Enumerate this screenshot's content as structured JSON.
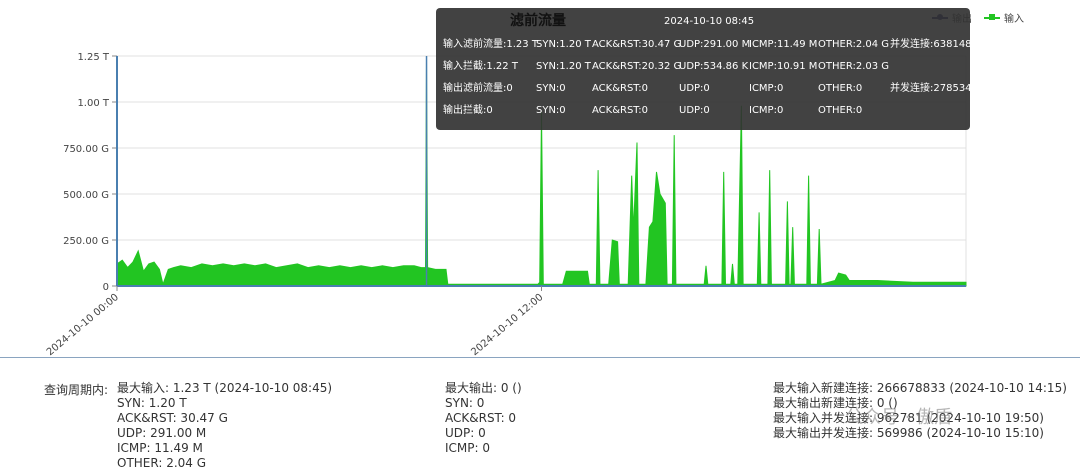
{
  "legend": {
    "output": "输出",
    "input": "输入"
  },
  "colors": {
    "input": "#22c522",
    "output": "#1a1a6e",
    "axis": "#4a7fb0",
    "grid": "#e0e0e0"
  },
  "tooltip": {
    "title": "滤前流量",
    "time": "2024-10-10 08:45",
    "rows": [
      [
        "输入滤前流量:1.23 T",
        "SYN:1.20 T",
        "ACK&RST:30.47 G",
        "UDP:291.00 M",
        "ICMP:11.49 M",
        "OTHER:2.04 G",
        "并发连接:638148"
      ],
      [
        "输入拦截:1.22 T",
        "SYN:1.20 T",
        "ACK&RST:20.32 G",
        "UDP:534.86 K",
        "ICMP:10.91 M",
        "OTHER:2.03 G",
        ""
      ],
      [
        "输出滤前流量:0",
        "SYN:0",
        "ACK&RST:0",
        "UDP:0",
        "ICMP:0",
        "OTHER:0",
        "并发连接:278534"
      ],
      [
        "输出拦截:0",
        "SYN:0",
        "ACK&RST:0",
        "UDP:0",
        "ICMP:0",
        "OTHER:0",
        ""
      ]
    ]
  },
  "chart_data": {
    "type": "area",
    "ylim": [
      0,
      1.25
    ],
    "y_unit": "T",
    "y_ticks": [
      0,
      0.25,
      0.5,
      0.75,
      1.0,
      1.25
    ],
    "y_tick_labels": [
      "0",
      "250.00 G",
      "500.00 G",
      "750.00 G",
      "1.00 T",
      "1.25 T"
    ],
    "x_range_hours": [
      0,
      24
    ],
    "x_tick_hours": [
      0,
      12
    ],
    "x_tick_labels": [
      "2024-10-10 00:00",
      "2024-10-10 12:00"
    ],
    "grid": true,
    "legend_position": "top-right",
    "series": [
      {
        "name": "输入",
        "points": [
          [
            0.0,
            0.12
          ],
          [
            0.15,
            0.14
          ],
          [
            0.3,
            0.1
          ],
          [
            0.45,
            0.13
          ],
          [
            0.6,
            0.19
          ],
          [
            0.75,
            0.08
          ],
          [
            0.9,
            0.12
          ],
          [
            1.05,
            0.13
          ],
          [
            1.2,
            0.09
          ],
          [
            1.3,
            0.01
          ],
          [
            1.45,
            0.09
          ],
          [
            1.6,
            0.1
          ],
          [
            1.8,
            0.11
          ],
          [
            2.1,
            0.1
          ],
          [
            2.4,
            0.12
          ],
          [
            2.7,
            0.11
          ],
          [
            3.0,
            0.12
          ],
          [
            3.3,
            0.11
          ],
          [
            3.6,
            0.12
          ],
          [
            3.9,
            0.11
          ],
          [
            4.2,
            0.12
          ],
          [
            4.5,
            0.1
          ],
          [
            4.8,
            0.11
          ],
          [
            5.1,
            0.12
          ],
          [
            5.4,
            0.1
          ],
          [
            5.7,
            0.11
          ],
          [
            6.0,
            0.1
          ],
          [
            6.3,
            0.11
          ],
          [
            6.6,
            0.1
          ],
          [
            6.9,
            0.11
          ],
          [
            7.2,
            0.1
          ],
          [
            7.5,
            0.11
          ],
          [
            7.8,
            0.1
          ],
          [
            8.1,
            0.11
          ],
          [
            8.4,
            0.11
          ],
          [
            8.6,
            0.1
          ],
          [
            8.72,
            0.1
          ],
          [
            8.75,
            1.23
          ],
          [
            8.78,
            0.1
          ],
          [
            9.0,
            0.09
          ],
          [
            9.3,
            0.09
          ],
          [
            9.35,
            0.01
          ],
          [
            10.0,
            0.01
          ],
          [
            11.0,
            0.01
          ],
          [
            11.9,
            0.01
          ],
          [
            11.95,
            0.02
          ],
          [
            12.0,
            0.95
          ],
          [
            12.05,
            0.01
          ],
          [
            12.6,
            0.01
          ],
          [
            12.7,
            0.08
          ],
          [
            13.3,
            0.08
          ],
          [
            13.35,
            0.01
          ],
          [
            13.55,
            0.01
          ],
          [
            13.6,
            0.63
          ],
          [
            13.65,
            0.01
          ],
          [
            13.9,
            0.01
          ],
          [
            14.0,
            0.25
          ],
          [
            14.15,
            0.24
          ],
          [
            14.2,
            0.01
          ],
          [
            14.45,
            0.01
          ],
          [
            14.55,
            0.6
          ],
          [
            14.6,
            0.3
          ],
          [
            14.7,
            0.78
          ],
          [
            14.75,
            0.01
          ],
          [
            14.95,
            0.01
          ],
          [
            15.05,
            0.32
          ],
          [
            15.15,
            0.35
          ],
          [
            15.25,
            0.62
          ],
          [
            15.35,
            0.5
          ],
          [
            15.5,
            0.45
          ],
          [
            15.55,
            0.01
          ],
          [
            15.7,
            0.01
          ],
          [
            15.75,
            0.82
          ],
          [
            15.8,
            0.01
          ],
          [
            16.6,
            0.01
          ],
          [
            16.65,
            0.11
          ],
          [
            16.7,
            0.01
          ],
          [
            17.1,
            0.01
          ],
          [
            17.15,
            0.62
          ],
          [
            17.2,
            0.01
          ],
          [
            17.35,
            0.01
          ],
          [
            17.4,
            0.12
          ],
          [
            17.45,
            0.01
          ],
          [
            17.55,
            0.01
          ],
          [
            17.65,
            0.98
          ],
          [
            17.7,
            0.01
          ],
          [
            18.1,
            0.01
          ],
          [
            18.15,
            0.4
          ],
          [
            18.2,
            0.01
          ],
          [
            18.4,
            0.01
          ],
          [
            18.45,
            0.63
          ],
          [
            18.5,
            0.01
          ],
          [
            18.9,
            0.01
          ],
          [
            18.95,
            0.46
          ],
          [
            19.0,
            0.01
          ],
          [
            19.05,
            0.01
          ],
          [
            19.1,
            0.32
          ],
          [
            19.15,
            0.01
          ],
          [
            19.5,
            0.01
          ],
          [
            19.55,
            0.6
          ],
          [
            19.6,
            0.01
          ],
          [
            19.8,
            0.01
          ],
          [
            19.85,
            0.31
          ],
          [
            19.9,
            0.01
          ],
          [
            20.3,
            0.03
          ],
          [
            20.4,
            0.07
          ],
          [
            20.6,
            0.06
          ],
          [
            20.7,
            0.03
          ],
          [
            21.5,
            0.03
          ],
          [
            22.5,
            0.02
          ],
          [
            23.5,
            0.02
          ],
          [
            24.0,
            0.02
          ]
        ]
      },
      {
        "name": "输出",
        "points": [
          [
            0,
            0
          ],
          [
            24,
            0
          ]
        ]
      }
    ]
  },
  "stats": {
    "period_label": "查询周期内:",
    "col1": [
      "最大输入: 1.23 T (2024-10-10 08:45)",
      "SYN: 1.20 T",
      "ACK&RST: 30.47 G",
      "UDP: 291.00 M",
      "ICMP: 11.49 M",
      "OTHER: 2.04 G"
    ],
    "col2": [
      "最大输出: 0 ()",
      "SYN: 0",
      "ACK&RST: 0",
      "UDP: 0",
      "ICMP: 0"
    ],
    "col3": [
      "最大输入新建连接: 266678833 (2024-10-10 14:15)",
      "最大输出新建连接: 0 ()",
      "最大输入并发连接: 962781 (2024-10-10 19:50)",
      "最大输出并发连接: 569986 (2024-10-10 15:10)"
    ]
  },
  "watermark": "公众号 · 傲盾"
}
